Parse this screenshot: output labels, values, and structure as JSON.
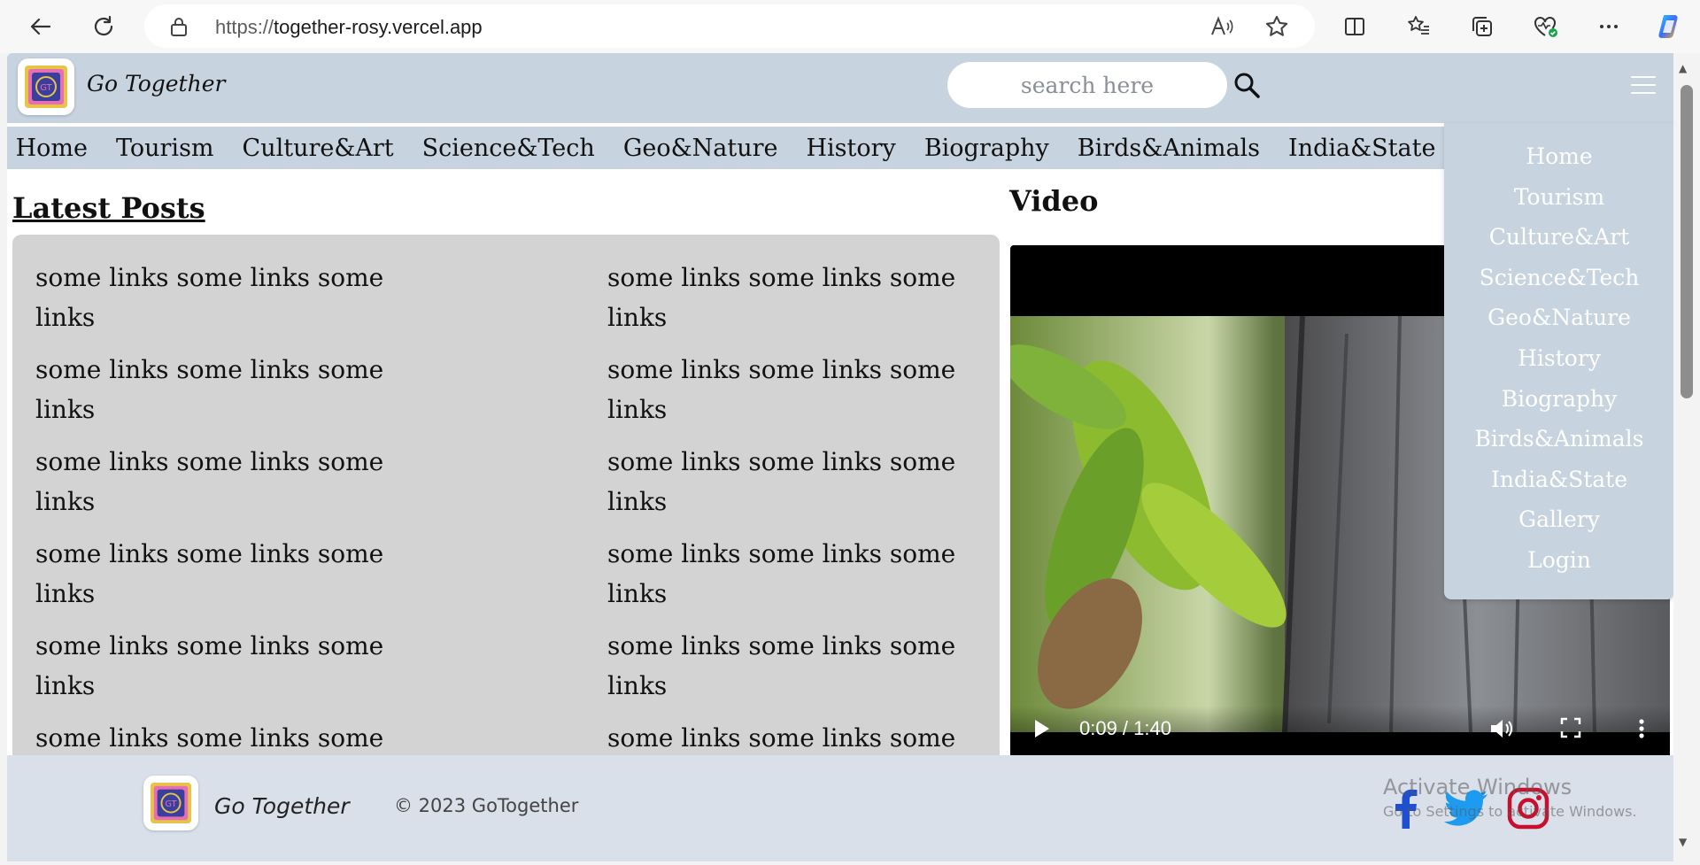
{
  "browser": {
    "url_protocol": "https://",
    "url_host": "together-rosy.vercel.app",
    "icons": [
      "back-icon",
      "refresh-icon",
      "lock-icon",
      "read-aloud-icon",
      "favorite-star-icon",
      "split-screen-icon",
      "favorites-icon",
      "collections-icon",
      "browser-essentials-icon",
      "more-icon",
      "copilot-icon"
    ]
  },
  "header": {
    "brand": "Go Together",
    "search_placeholder": "search here"
  },
  "nav": {
    "items": [
      "Home",
      "Tourism",
      "Culture&Art",
      "Science&Tech",
      "Geo&Nature",
      "History",
      "Biography",
      "Birds&Animals",
      "India&State"
    ]
  },
  "dropdown": {
    "items": [
      "Home",
      "Tourism",
      "Culture&Art",
      "Science&Tech",
      "Geo&Nature",
      "History",
      "Biography",
      "Birds&Animals",
      "India&State",
      "Gallery",
      "Login"
    ]
  },
  "latest": {
    "title": "Latest Posts",
    "links": [
      "some links some links some links",
      "some links some links some links",
      "some links some links some links",
      "some links some links some links",
      "some links some links some links",
      "some links some links some links",
      "some links some links some links",
      "some links some links some links",
      "some links some links some links",
      "some links some links some links",
      "some links some links some links",
      "some links some links some links"
    ]
  },
  "video": {
    "title": "Video",
    "time": "0:09 / 1:40",
    "progress": 0.09
  },
  "footer": {
    "brand": "Go Together",
    "copyright": "© 2023 GoTogether",
    "social": [
      "facebook-icon",
      "twitter-icon",
      "instagram-icon"
    ]
  },
  "watermark": {
    "line1": "Activate Windows",
    "line2": "Go to Settings to activate Windows."
  },
  "colors": {
    "header_bg": "#c8d3e0",
    "footer_bg": "#d9e0ea",
    "posts_bg": "#d3d3d3",
    "facebook": "#1f4fd1",
    "twitter": "#1d9bf0",
    "instagram": "#c8102e"
  }
}
